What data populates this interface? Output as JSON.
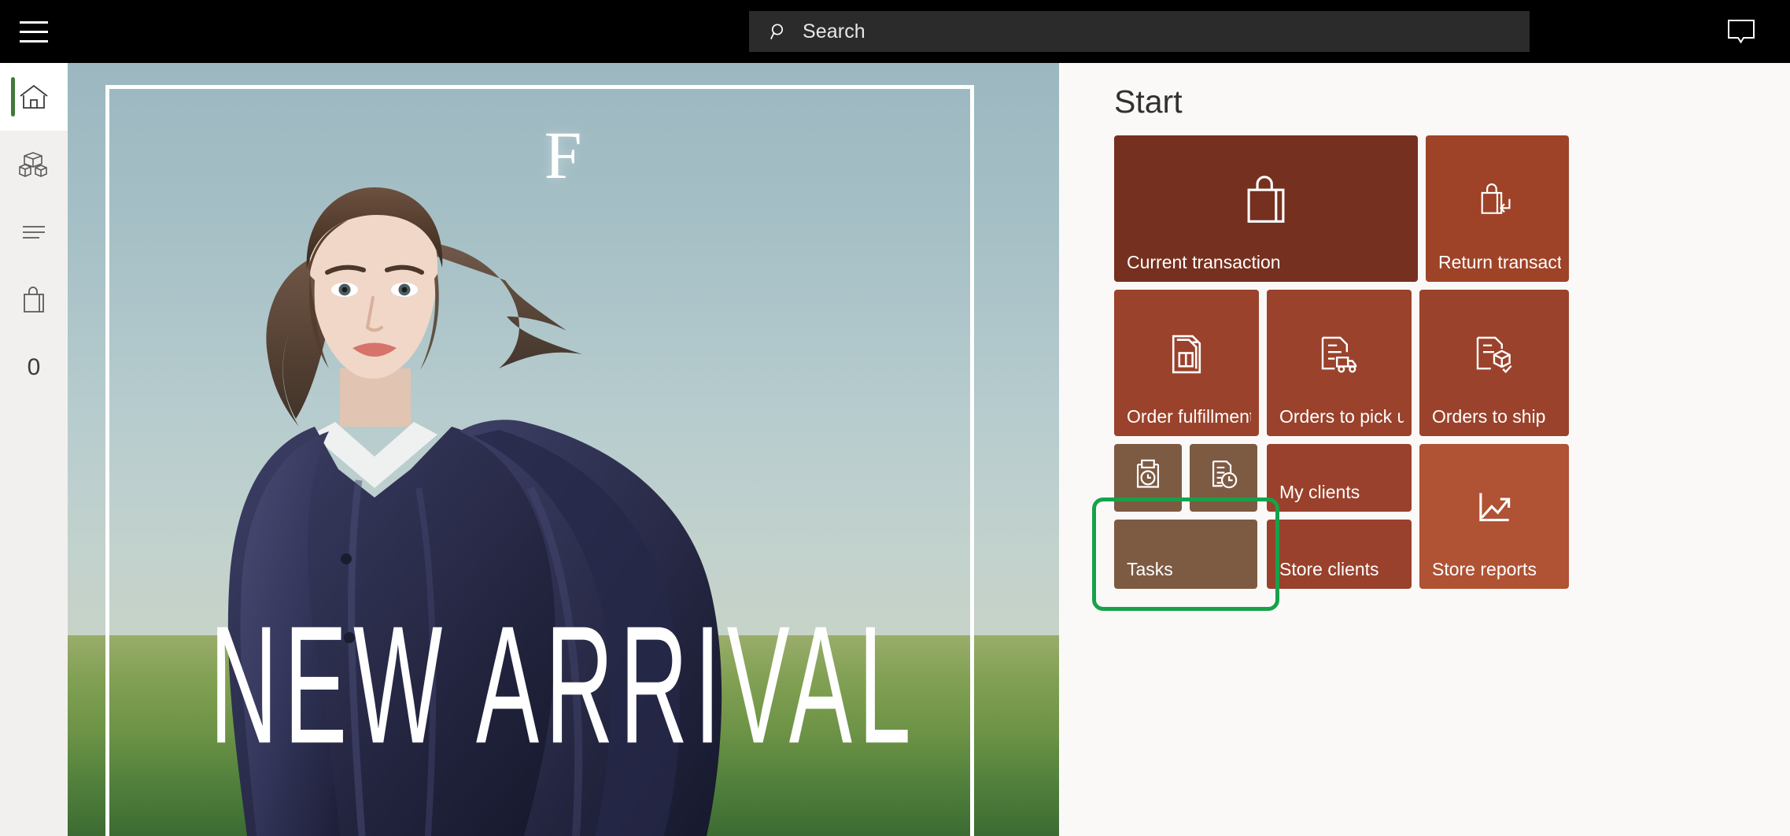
{
  "header": {
    "menu_icon": "hamburger-menu-icon",
    "search": {
      "placeholder": "Search",
      "value": "",
      "icon": "search-icon"
    },
    "notifications_icon": "notification-bubble-icon"
  },
  "sidebar": {
    "items": [
      {
        "name": "home",
        "icon": "home-icon",
        "selected": true
      },
      {
        "name": "products",
        "icon": "boxes-icon",
        "selected": false
      },
      {
        "name": "journal",
        "icon": "list-lines-icon",
        "selected": false
      },
      {
        "name": "cart",
        "icon": "shopping-bag-icon",
        "selected": false
      }
    ],
    "cart_count": "0",
    "accent_color": "#3f7a36"
  },
  "hero": {
    "logo": "F",
    "headline": "NEW ARRIVAL",
    "alt": "fashion-campaign-photo"
  },
  "start": {
    "title": "Start",
    "selected_tile": "Tasks",
    "selection_color": "#17a24a",
    "panel_background": "#faf9f8",
    "tiles": [
      {
        "label": "Current transaction",
        "icon": "shopping-bag-icon",
        "color": "#76301f",
        "size": "wide-tall"
      },
      {
        "label": "Return transaction",
        "icon": "bag-return-icon",
        "color": "#9e4328",
        "size": "tall"
      },
      {
        "label": "Order fulfillment",
        "icon": "order-document-icon",
        "color": "#9a422c",
        "size": "tall"
      },
      {
        "label": "Orders to pick up",
        "icon": "document-truck-icon",
        "color": "#9a422c",
        "size": "tall"
      },
      {
        "label": "Orders to ship",
        "icon": "document-box-check-icon",
        "color": "#9a422c",
        "size": "tall"
      },
      {
        "label": "",
        "icon": "clipboard-clock-icon",
        "color": "#7d5a42",
        "size": "small"
      },
      {
        "label": "",
        "icon": "document-clock-icon",
        "color": "#7d5a42",
        "size": "small"
      },
      {
        "label": "My clients",
        "icon": "",
        "color": "#99412c",
        "size": "medium"
      },
      {
        "label": "Tasks",
        "icon": "",
        "color": "#7d5a42",
        "size": "medium-wide"
      },
      {
        "label": "Store clients",
        "icon": "",
        "color": "#99412c",
        "size": "medium"
      },
      {
        "label": "Store reports",
        "icon": "trend-chart-icon",
        "color": "#b05234",
        "size": "tall"
      }
    ]
  }
}
